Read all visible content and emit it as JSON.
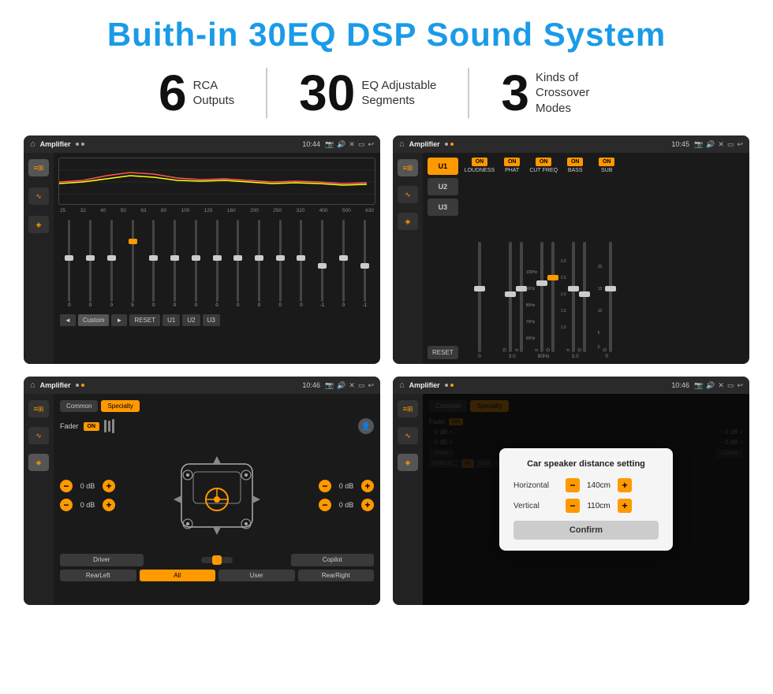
{
  "header": {
    "title": "Buith-in 30EQ DSP Sound System"
  },
  "stats": [
    {
      "number": "6",
      "desc_line1": "RCA",
      "desc_line2": "Outputs"
    },
    {
      "number": "30",
      "desc_line1": "EQ Adjustable",
      "desc_line2": "Segments"
    },
    {
      "number": "3",
      "desc_line1": "Kinds of",
      "desc_line2": "Crossover Modes"
    }
  ],
  "screen1": {
    "topbar": {
      "title": "Amplifier",
      "time": "10:44"
    },
    "freq_labels": [
      "25",
      "32",
      "40",
      "50",
      "63",
      "80",
      "100",
      "125",
      "160",
      "200",
      "250",
      "320",
      "400",
      "500",
      "630"
    ],
    "slider_values": [
      "0",
      "0",
      "0",
      "5",
      "0",
      "0",
      "0",
      "0",
      "0",
      "0",
      "0",
      "0",
      "-1",
      "0",
      "-1"
    ],
    "slider_positions": [
      50,
      50,
      50,
      30,
      50,
      50,
      50,
      50,
      50,
      50,
      50,
      50,
      60,
      50,
      60
    ],
    "bottom_buttons": [
      "◄",
      "Custom",
      "►",
      "RESET",
      "U1",
      "U2",
      "U3"
    ]
  },
  "screen2": {
    "topbar": {
      "title": "Amplifier",
      "time": "10:45"
    },
    "presets": [
      "U1",
      "U2",
      "U3"
    ],
    "controls": [
      {
        "label": "LOUDNESS",
        "on": true
      },
      {
        "label": "PHAT",
        "on": true
      },
      {
        "label": "CUT FREQ",
        "on": true
      },
      {
        "label": "BASS",
        "on": true
      },
      {
        "label": "SUB",
        "on": true
      }
    ],
    "reset_label": "RESET"
  },
  "screen3": {
    "topbar": {
      "title": "Amplifier",
      "time": "10:46"
    },
    "tabs": [
      "Common",
      "Specialty"
    ],
    "fader_label": "Fader",
    "fader_on": "ON",
    "vol_controls": [
      {
        "label": "0 dB",
        "side": "left-top"
      },
      {
        "label": "0 dB",
        "side": "left-bottom"
      },
      {
        "label": "0 dB",
        "side": "right-top"
      },
      {
        "label": "0 dB",
        "side": "right-bottom"
      }
    ],
    "bottom_buttons": [
      "Driver",
      "",
      "Copilot",
      "RearLeft",
      "All",
      "User",
      "RearRight"
    ]
  },
  "screen4": {
    "topbar": {
      "title": "Amplifier",
      "time": "10:46"
    },
    "tabs": [
      "Common",
      "Specialty"
    ],
    "dialog": {
      "title": "Car speaker distance setting",
      "horizontal_label": "Horizontal",
      "horizontal_value": "140cm",
      "vertical_label": "Vertical",
      "vertical_value": "110cm",
      "confirm_label": "Confirm"
    },
    "bottom_buttons": [
      "Driver",
      "Copilot",
      "RearLef...",
      "User",
      "RearRight"
    ]
  }
}
